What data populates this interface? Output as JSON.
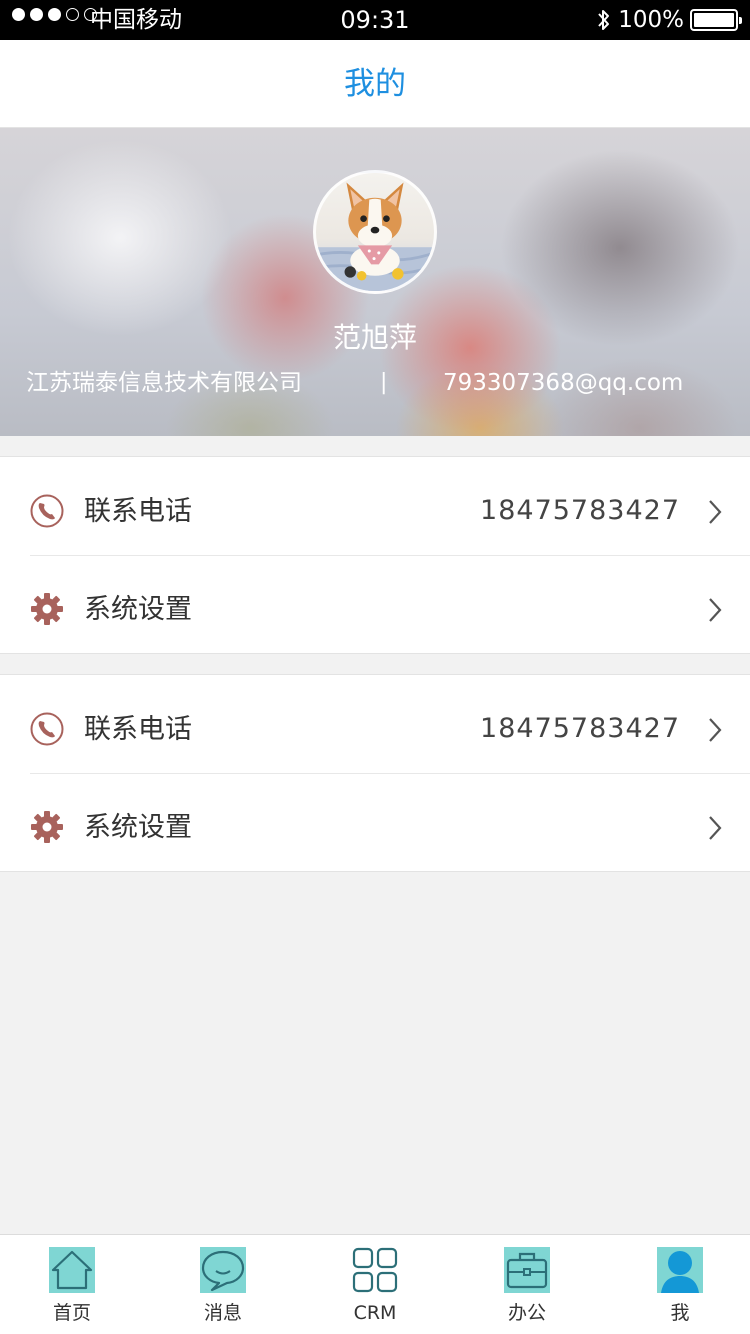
{
  "status_bar": {
    "signal_dots": [
      true,
      true,
      true,
      false,
      false
    ],
    "carrier": "中国移动",
    "time": "09:31",
    "battery_text": "100%",
    "battery_level": 1.0
  },
  "header": {
    "title": "我的",
    "title_color": "#1e8fe0"
  },
  "profile": {
    "name": "范旭萍",
    "company": "江苏瑞泰信息技术有限公司",
    "separator": "|",
    "email": "793307368@qq.com",
    "avatar_icon": "corgi-photo"
  },
  "sections": [
    {
      "items": [
        {
          "icon": "phone-icon",
          "label": "联系电话",
          "value": "18475783427"
        },
        {
          "icon": "gear-icon",
          "label": "系统设置",
          "value": ""
        }
      ]
    },
    {
      "items": [
        {
          "icon": "phone-icon",
          "label": "联系电话",
          "value": "18475783427"
        },
        {
          "icon": "gear-icon",
          "label": "系统设置",
          "value": ""
        }
      ]
    }
  ],
  "tabbar": {
    "tabs": [
      {
        "label": "首页",
        "icon": "home-icon"
      },
      {
        "label": "消息",
        "icon": "message-icon"
      },
      {
        "label": "CRM",
        "icon": "grid-icon"
      },
      {
        "label": "办公",
        "icon": "briefcase-icon"
      },
      {
        "label": "我",
        "icon": "person-icon"
      }
    ],
    "active_index": 4,
    "accent_color": "#2bb6c9"
  }
}
